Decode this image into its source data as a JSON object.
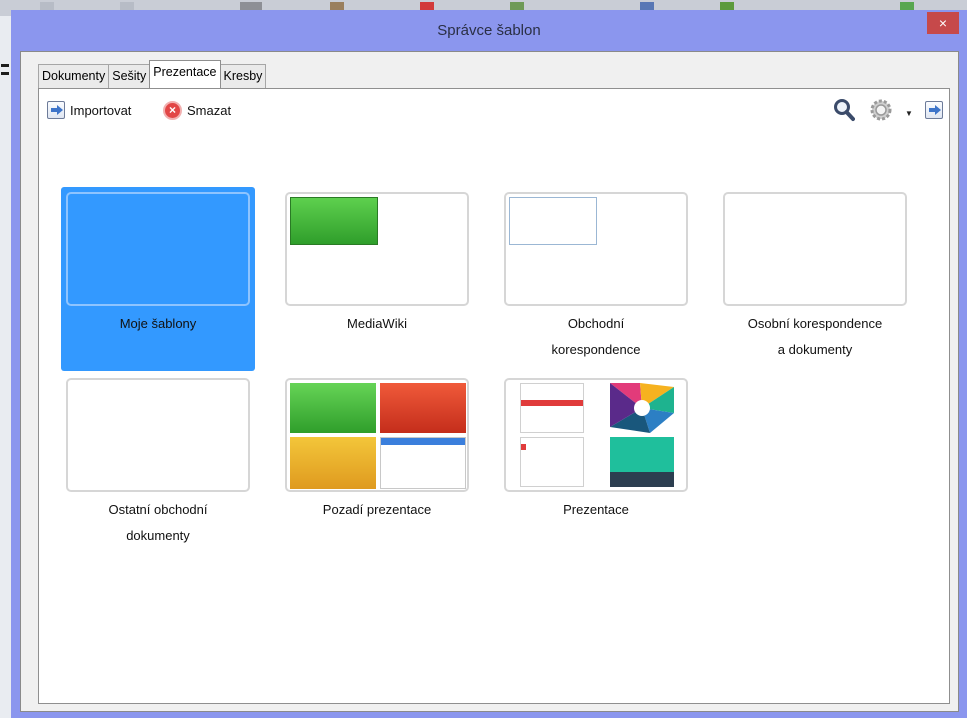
{
  "dialog": {
    "title": "Správce šablon",
    "close_label": "×"
  },
  "tabs": [
    {
      "label": "Dokumenty",
      "active": false
    },
    {
      "label": "Sešity",
      "active": false
    },
    {
      "label": "Prezentace",
      "active": true
    },
    {
      "label": "Kresby",
      "active": false
    }
  ],
  "toolbar": {
    "import_label": "Importovat",
    "delete_label": "Smazat",
    "icons": [
      "import-icon",
      "delete-icon",
      "search-icon",
      "gear-icon",
      "chevron-down-icon",
      "import-icon"
    ]
  },
  "templates": [
    {
      "name": "Moje šablony",
      "selected": true
    },
    {
      "name": "MediaWiki",
      "selected": false
    },
    {
      "name": "Obchodní\nkorespondence",
      "selected": false
    },
    {
      "name": "Osobní korespondence\na dokumenty",
      "selected": false
    },
    {
      "name": "Ostatní obchodní\ndokumenty",
      "selected": false
    },
    {
      "name": "Pozadí prezentace",
      "selected": false
    },
    {
      "name": "Prezentace",
      "selected": false
    }
  ],
  "colors": {
    "selection": "#3399ff",
    "title_bar": "#8b96ee",
    "close_button": "#c6494a"
  }
}
